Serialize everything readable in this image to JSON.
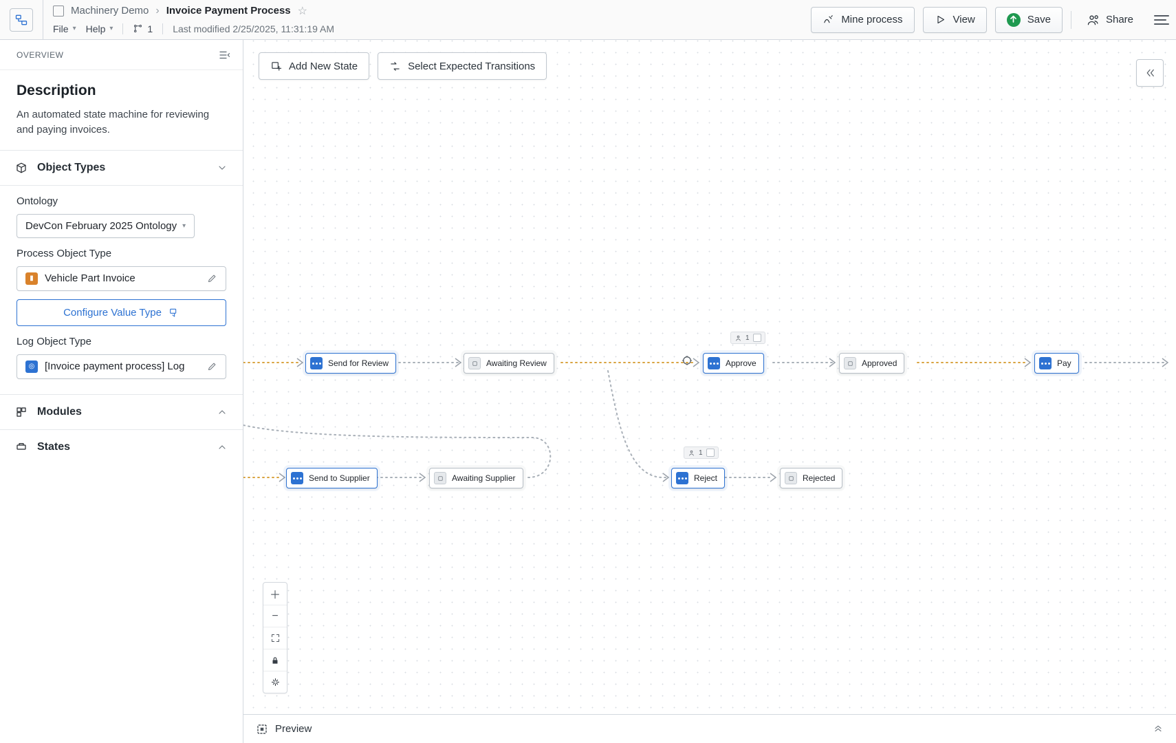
{
  "breadcrumb": {
    "parent": "Machinery Demo",
    "title": "Invoice Payment Process"
  },
  "menus": {
    "file": "File",
    "help": "Help",
    "branch_count": "1",
    "last_modified": "Last modified 2/25/2025, 11:31:19 AM"
  },
  "header_buttons": {
    "mine": "Mine process",
    "view": "View",
    "save": "Save",
    "share": "Share"
  },
  "sidebar": {
    "overview": "OVERVIEW",
    "description_heading": "Description",
    "description_body": "An automated state machine for reviewing and paying invoices.",
    "object_types": "Object Types",
    "ontology_label": "Ontology",
    "ontology_value": "DevCon February 2025 Ontology",
    "process_obj_label": "Process Object Type",
    "process_obj_value": "Vehicle Part Invoice",
    "configure_value_type": "Configure Value Type",
    "log_obj_label": "Log Object Type",
    "log_obj_value": "[Invoice payment process] Log",
    "modules": "Modules",
    "states": "States"
  },
  "canvas": {
    "add_state": "Add New State",
    "select_transitions": "Select Expected Transitions",
    "preview": "Preview",
    "badge1": "1",
    "badge2": "1"
  },
  "nodes": {
    "send_for_review": "Send for Review",
    "awaiting_review": "Awaiting Review",
    "approve": "Approve",
    "approved": "Approved",
    "pay": "Pay",
    "send_to_supplier": "Send to Supplier",
    "awaiting_supplier": "Awaiting Supplier",
    "reject": "Reject",
    "rejected": "Rejected"
  }
}
